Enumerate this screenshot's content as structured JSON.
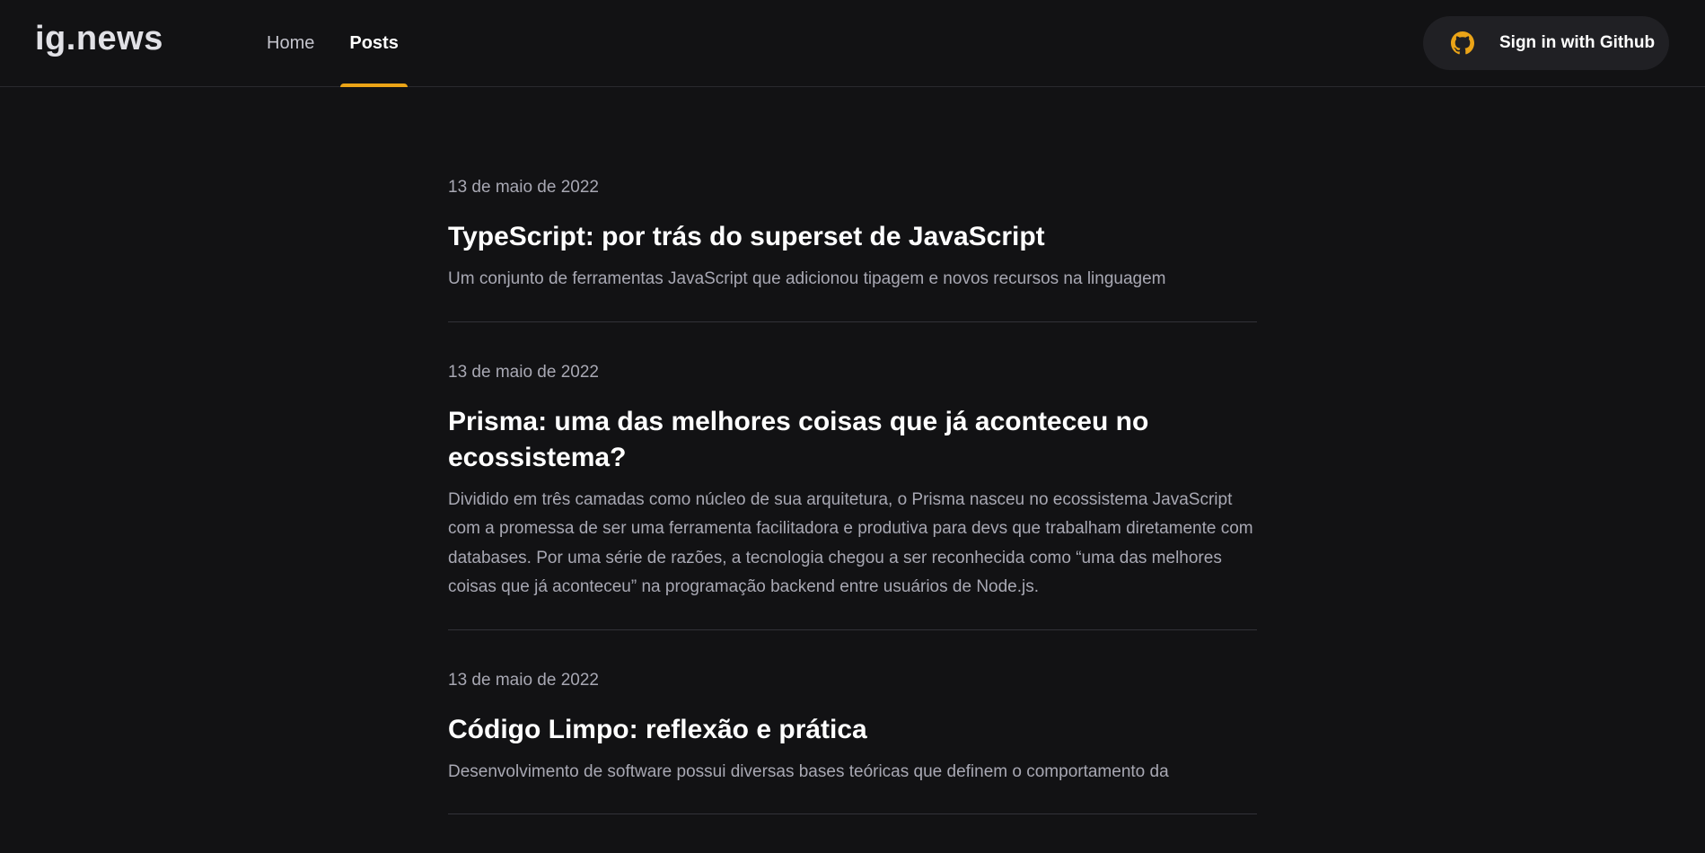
{
  "header": {
    "logo": "ig.news",
    "nav": [
      {
        "label": "Home",
        "active": false
      },
      {
        "label": "Posts",
        "active": true
      }
    ],
    "signin_label": "Sign in with Github",
    "signin_icon": "github-icon",
    "accent_color": "#eba417"
  },
  "posts": [
    {
      "date": "13 de maio de 2022",
      "title": "TypeScript: por trás do superset de JavaScript",
      "excerpt": "Um conjunto de ferramentas JavaScript que adicionou tipagem e novos recursos na linguagem"
    },
    {
      "date": "13 de maio de 2022",
      "title": "Prisma: uma das melhores coisas que já aconteceu no ecossistema?",
      "excerpt": "Dividido em três camadas como núcleo de sua arquitetura, o Prisma nasceu no ecossistema JavaScript com a promessa de ser uma ferramenta facilitadora e produtiva para devs que trabalham diretamente com databases. Por uma série de razões, a tecnologia chegou a ser reconhecida como “uma das melhores coisas que já aconteceu” na programação backend entre usuários de Node.js."
    },
    {
      "date": "13 de maio de 2022",
      "title": "Código Limpo: reflexão e prática",
      "excerpt": "Desenvolvimento de software possui diversas bases teóricas que definem o comportamento da"
    }
  ]
}
